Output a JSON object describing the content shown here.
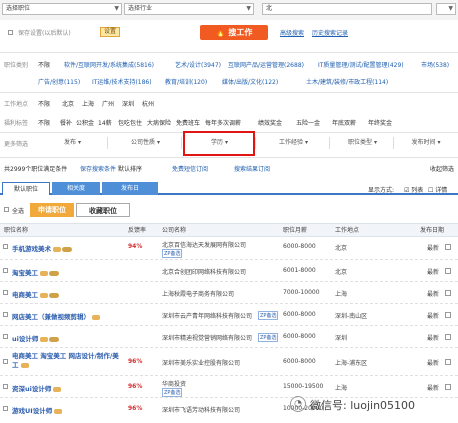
{
  "search": {
    "function_select": "选择职位",
    "industry_select": "选择行业",
    "city_value": "北",
    "save_checkbox_label": "保存设置(以后默认)",
    "settings_button": "设置",
    "search_button": "搜工作",
    "link_advanced": "高级搜索",
    "link_history": "历史搜索记录"
  },
  "filters": {
    "function_label": "职位类别",
    "function_items_1": [
      "不限",
      "软件/互联网开发/系统集成(5816)",
      "艺术/设计(3947)",
      "互联网产品/运营管理(2688)",
      "IT质量管理/测试/配置管理(429)",
      "市场(538)"
    ],
    "function_items_2": [
      "广告/创意(115)",
      "IT运维/技术支持(186)",
      "教育/培训(120)",
      "媒体/出版/文化(122)",
      "土木/建筑/装修/市政工程(114)"
    ],
    "work_location_label": "工作地点",
    "work_locations": [
      "不限",
      "北京",
      "上海",
      "广州",
      "深圳",
      "杭州"
    ],
    "benefit_label": "福利标签",
    "benefits": [
      "不限",
      "餐补",
      "公积金",
      "14薪",
      "包吃包住",
      "大病保险",
      "免费班车",
      "每年多次调薪",
      "绩效奖金",
      "五险一金",
      "年底双薪",
      "年终奖金"
    ],
    "more_label": "更多筛选",
    "dropdowns": [
      "发布",
      "公司性质",
      "学历",
      "工作经验",
      "职位类型",
      "发布时间"
    ]
  },
  "result_bar": {
    "count_text": "共2999个职位满足条件",
    "subscribe_text": "保存搜索条件",
    "sort_text": "默认排序",
    "app_text": "免费短信订阅",
    "email_text": "搜索结果订阅",
    "close_text": "收起筛选"
  },
  "tabs": {
    "items": [
      "默认职位",
      "相关度",
      "发布日"
    ],
    "view_label": "显示方式:",
    "view_options": [
      "列表",
      "详情"
    ]
  },
  "actions": {
    "select_all": "全选",
    "apply": "申请职位",
    "favorite": "收藏职位"
  },
  "table": {
    "headers": [
      "职位名称",
      "反馈率",
      "公司名称",
      "职位月薪",
      "工作地点",
      "发布日期"
    ],
    "rows": [
      {
        "title": "手机游戏美术",
        "feedback": "94%",
        "company": "北京百信海达天发展网有限公司",
        "tag": "ZP备选",
        "salary": "6000-8000",
        "location": "北京",
        "date": "最新"
      },
      {
        "title": "淘宝美工",
        "feedback": "",
        "company": "北京合创团印网络科技有限公司",
        "tag": "",
        "salary": "6001-8000",
        "location": "北京",
        "date": "最新"
      },
      {
        "title": "电商美工",
        "feedback": "",
        "company": "上海秋霞电子商务有限公司",
        "tag": "",
        "salary": "7000-10000",
        "location": "上海",
        "date": "最新"
      },
      {
        "title": "网店美工（兼做视频剪辑）",
        "feedback": "",
        "company": "深圳市云产青年网络科技有限公司",
        "tag": "ZP备选",
        "salary": "6000-8000",
        "location": "深圳-南山区",
        "date": "最新"
      },
      {
        "title": "ui设计师",
        "feedback": "",
        "company": "深圳市精迪视觉营销网络有限公司",
        "tag": "ZP备选",
        "salary": "6000-8000",
        "location": "深圳",
        "date": "最新"
      },
      {
        "title": "电商美工 淘宝美工 网店设计/制作/美工",
        "feedback": "96%",
        "company": "深圳市美乐实业控股有限公司",
        "tag": "",
        "salary": "6000-8000",
        "location": "上海-浦东区",
        "date": "最新"
      },
      {
        "title": "资深ui设计师",
        "feedback": "96%",
        "company": "华商投资",
        "tag": "ZP备选",
        "salary": "15000-19500",
        "location": "上海",
        "date": "最新"
      },
      {
        "title": "游戏UI设计师",
        "feedback": "96%",
        "company": "深圳市飞语芳动科技有限公司",
        "tag": "ZP备选",
        "salary": "10000-20000",
        "location": "深圳",
        "date": "最新"
      }
    ]
  },
  "watermark": {
    "text": "微信号: luojin05100"
  }
}
